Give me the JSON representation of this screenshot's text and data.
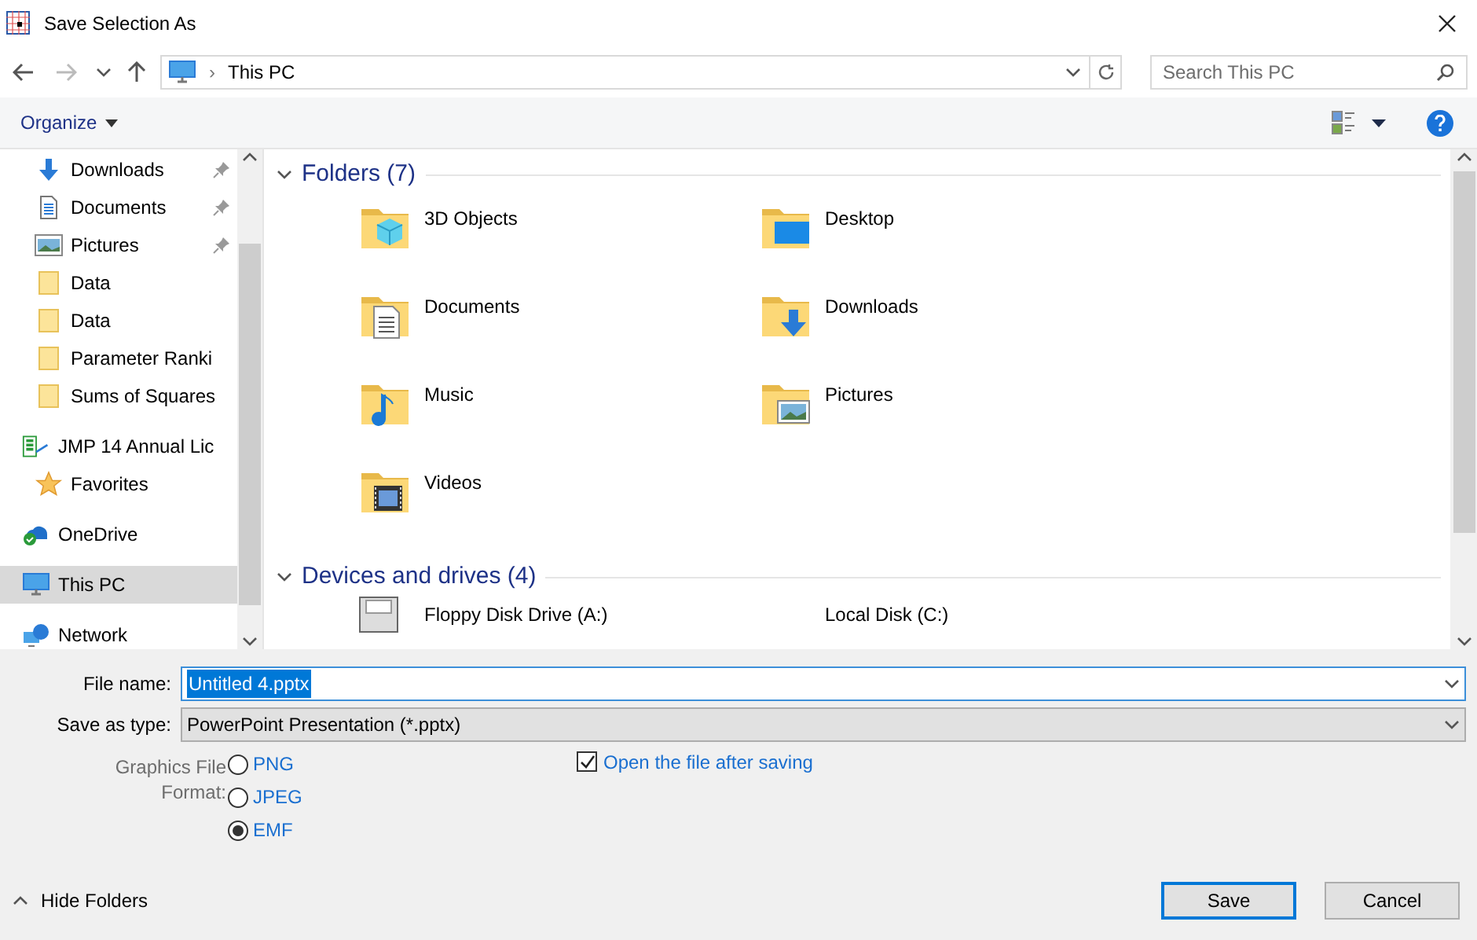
{
  "window": {
    "title": "Save Selection As"
  },
  "address": {
    "separator": "›",
    "location": "This PC",
    "search_placeholder": "Search This PC"
  },
  "toolbar": {
    "organize": "Organize"
  },
  "sidebar": {
    "items": [
      {
        "label": "Downloads",
        "pinned": true,
        "selected": false
      },
      {
        "label": "Documents",
        "pinned": true,
        "selected": false
      },
      {
        "label": "Pictures",
        "pinned": true,
        "selected": false
      },
      {
        "label": "Data",
        "pinned": false,
        "selected": false
      },
      {
        "label": "Data",
        "pinned": false,
        "selected": false
      },
      {
        "label": "Parameter Ranki",
        "pinned": false,
        "selected": false
      },
      {
        "label": "Sums of Squares",
        "pinned": false,
        "selected": false
      },
      {
        "label": "JMP 14 Annual Lic",
        "pinned": false,
        "selected": false
      },
      {
        "label": "Favorites",
        "pinned": false,
        "selected": false
      },
      {
        "label": "OneDrive",
        "pinned": false,
        "selected": false
      },
      {
        "label": "This PC",
        "pinned": false,
        "selected": true
      },
      {
        "label": "Network",
        "pinned": false,
        "selected": false
      }
    ]
  },
  "groups": [
    {
      "title": "Folders (7)",
      "expanded": true,
      "items": [
        {
          "label": "3D Objects"
        },
        {
          "label": "Desktop"
        },
        {
          "label": "Documents"
        },
        {
          "label": "Downloads"
        },
        {
          "label": "Music"
        },
        {
          "label": "Pictures"
        },
        {
          "label": "Videos"
        }
      ]
    },
    {
      "title": "Devices and drives (4)",
      "expanded": true,
      "items": [
        {
          "label": "Floppy Disk Drive (A:)"
        },
        {
          "label": "Local Disk (C:)"
        }
      ]
    }
  ],
  "form": {
    "file_name_label": "File name:",
    "file_name": "Untitled 4.pptx",
    "type_label": "Save as type:",
    "type": "PowerPoint Presentation (*.pptx)",
    "format_label": "Graphics File Format:",
    "formats": [
      {
        "label": "PNG",
        "selected": false
      },
      {
        "label": "JPEG",
        "selected": false
      },
      {
        "label": "EMF",
        "selected": true
      }
    ],
    "open_after": {
      "label": "Open the file after saving",
      "checked": true
    }
  },
  "footer": {
    "hide_folders": "Hide Folders",
    "buttons": [
      {
        "label": "Save",
        "kind": "primary"
      },
      {
        "label": "Cancel",
        "kind": "secondary"
      }
    ]
  }
}
